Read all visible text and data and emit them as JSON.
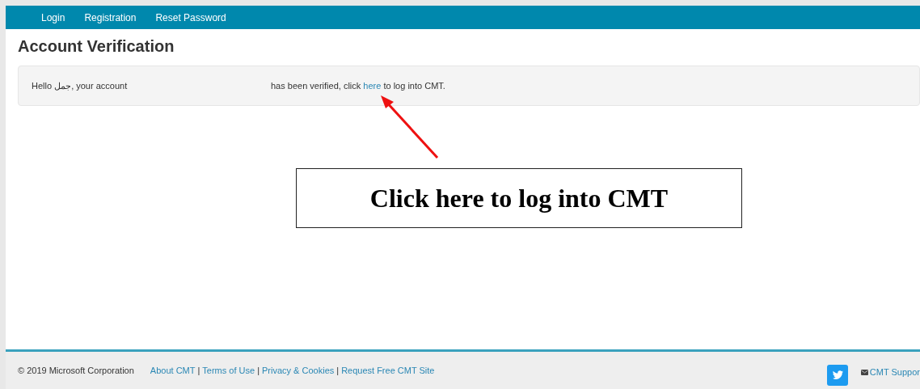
{
  "nav": {
    "items": [
      {
        "label": "Login"
      },
      {
        "label": "Registration"
      },
      {
        "label": "Reset Password"
      }
    ]
  },
  "page": {
    "title": "Account Verification",
    "message": {
      "greeting": "Hello جمل, your account",
      "before_link": "has been verified, click",
      "link": "here",
      "after_link": "to log into CMT."
    }
  },
  "annotation": {
    "callout": "Click here to log into CMT"
  },
  "footer": {
    "copyright": "© 2019 Microsoft Corporation",
    "separator": "|",
    "links": [
      {
        "label": "About CMT"
      },
      {
        "label": "Terms of Use"
      },
      {
        "label": "Privacy & Cookies"
      },
      {
        "label": "Request Free CMT Site"
      }
    ],
    "support": "CMT Suppor"
  }
}
